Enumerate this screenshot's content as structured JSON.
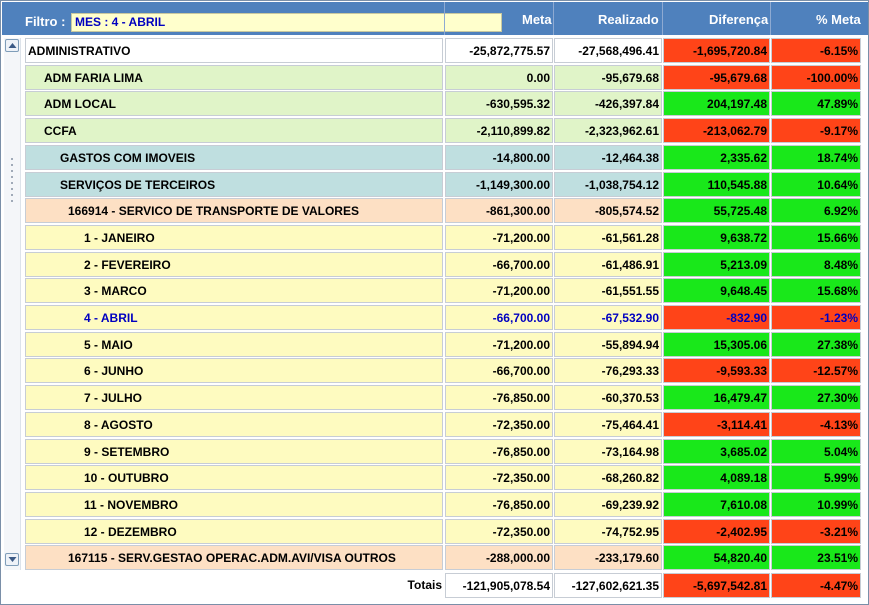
{
  "header": {
    "filter_label": "Filtro :",
    "filter_value": "MES : 4 - ABRIL",
    "col_meta": "Meta",
    "col_realizado": "Realizado",
    "col_diferenca": "Diferença",
    "col_pct_meta": "% Meta"
  },
  "colors": {
    "header_bg": "#4f81bd",
    "negative": "#ff4418",
    "positive": "#19e81a",
    "level0": "#ffffff",
    "level1": "#e0f4c8",
    "level2": "#bfdfe0",
    "level3": "#fde0c4",
    "level4": "#fefbc0",
    "selected_text": "#0000c0"
  },
  "rows": [
    {
      "name": "ADMINISTRATIVO",
      "level": 0,
      "meta": "-25,872,775.57",
      "realizado": "-27,568,496.41",
      "diferenca": "-1,695,720.84",
      "pct": "-6.15%",
      "sign": "neg"
    },
    {
      "name": "ADM FARIA LIMA",
      "level": 1,
      "meta": "0.00",
      "realizado": "-95,679.68",
      "diferenca": "-95,679.68",
      "pct": "-100.00%",
      "sign": "neg"
    },
    {
      "name": "ADM LOCAL",
      "level": 1,
      "meta": "-630,595.32",
      "realizado": "-426,397.84",
      "diferenca": "204,197.48",
      "pct": "47.89%",
      "sign": "pos"
    },
    {
      "name": "CCFA",
      "level": 1,
      "meta": "-2,110,899.82",
      "realizado": "-2,323,962.61",
      "diferenca": "-213,062.79",
      "pct": "-9.17%",
      "sign": "neg"
    },
    {
      "name": "GASTOS COM IMOVEIS",
      "level": 2,
      "meta": "-14,800.00",
      "realizado": "-12,464.38",
      "diferenca": "2,335.62",
      "pct": "18.74%",
      "sign": "pos"
    },
    {
      "name": "SERVIÇOS DE TERCEIROS",
      "level": 2,
      "meta": "-1,149,300.00",
      "realizado": "-1,038,754.12",
      "diferenca": "110,545.88",
      "pct": "10.64%",
      "sign": "pos"
    },
    {
      "name": "166914 - SERVICO DE TRANSPORTE DE VALORES",
      "level": 3,
      "meta": "-861,300.00",
      "realizado": "-805,574.52",
      "diferenca": "55,725.48",
      "pct": "6.92%",
      "sign": "pos"
    },
    {
      "name": "1 - JANEIRO",
      "level": 4,
      "meta": "-71,200.00",
      "realizado": "-61,561.28",
      "diferenca": "9,638.72",
      "pct": "15.66%",
      "sign": "pos"
    },
    {
      "name": "2 - FEVEREIRO",
      "level": 4,
      "meta": "-66,700.00",
      "realizado": "-61,486.91",
      "diferenca": "5,213.09",
      "pct": "8.48%",
      "sign": "pos"
    },
    {
      "name": "3 - MARCO",
      "level": 4,
      "meta": "-71,200.00",
      "realizado": "-61,551.55",
      "diferenca": "9,648.45",
      "pct": "15.68%",
      "sign": "pos"
    },
    {
      "name": "4 - ABRIL",
      "level": 4,
      "meta": "-66,700.00",
      "realizado": "-67,532.90",
      "diferenca": "-832.90",
      "pct": "-1.23%",
      "sign": "neg",
      "selected": true
    },
    {
      "name": "5 - MAIO",
      "level": 4,
      "meta": "-71,200.00",
      "realizado": "-55,894.94",
      "diferenca": "15,305.06",
      "pct": "27.38%",
      "sign": "pos"
    },
    {
      "name": "6 - JUNHO",
      "level": 4,
      "meta": "-66,700.00",
      "realizado": "-76,293.33",
      "diferenca": "-9,593.33",
      "pct": "-12.57%",
      "sign": "neg"
    },
    {
      "name": "7 - JULHO",
      "level": 4,
      "meta": "-76,850.00",
      "realizado": "-60,370.53",
      "diferenca": "16,479.47",
      "pct": "27.30%",
      "sign": "pos"
    },
    {
      "name": "8 - AGOSTO",
      "level": 4,
      "meta": "-72,350.00",
      "realizado": "-75,464.41",
      "diferenca": "-3,114.41",
      "pct": "-4.13%",
      "sign": "neg"
    },
    {
      "name": "9 - SETEMBRO",
      "level": 4,
      "meta": "-76,850.00",
      "realizado": "-73,164.98",
      "diferenca": "3,685.02",
      "pct": "5.04%",
      "sign": "pos"
    },
    {
      "name": "10 - OUTUBRO",
      "level": 4,
      "meta": "-72,350.00",
      "realizado": "-68,260.82",
      "diferenca": "4,089.18",
      "pct": "5.99%",
      "sign": "pos"
    },
    {
      "name": "11 - NOVEMBRO",
      "level": 4,
      "meta": "-76,850.00",
      "realizado": "-69,239.92",
      "diferenca": "7,610.08",
      "pct": "10.99%",
      "sign": "pos"
    },
    {
      "name": "12 - DEZEMBRO",
      "level": 4,
      "meta": "-72,350.00",
      "realizado": "-74,752.95",
      "diferenca": "-2,402.95",
      "pct": "-3.21%",
      "sign": "neg"
    },
    {
      "name": "167115 - SERV.GESTAO OPERAC.ADM.AVI/VISA OUTROS",
      "level": 3,
      "meta": "-288,000.00",
      "realizado": "-233,179.60",
      "diferenca": "54,820.40",
      "pct": "23.51%",
      "sign": "pos"
    }
  ],
  "totals": {
    "label": "Totais",
    "meta": "-121,905,078.54",
    "realizado": "-127,602,621.35",
    "diferenca": "-5,697,542.81",
    "pct": "-4.47%",
    "sign": "neg"
  }
}
